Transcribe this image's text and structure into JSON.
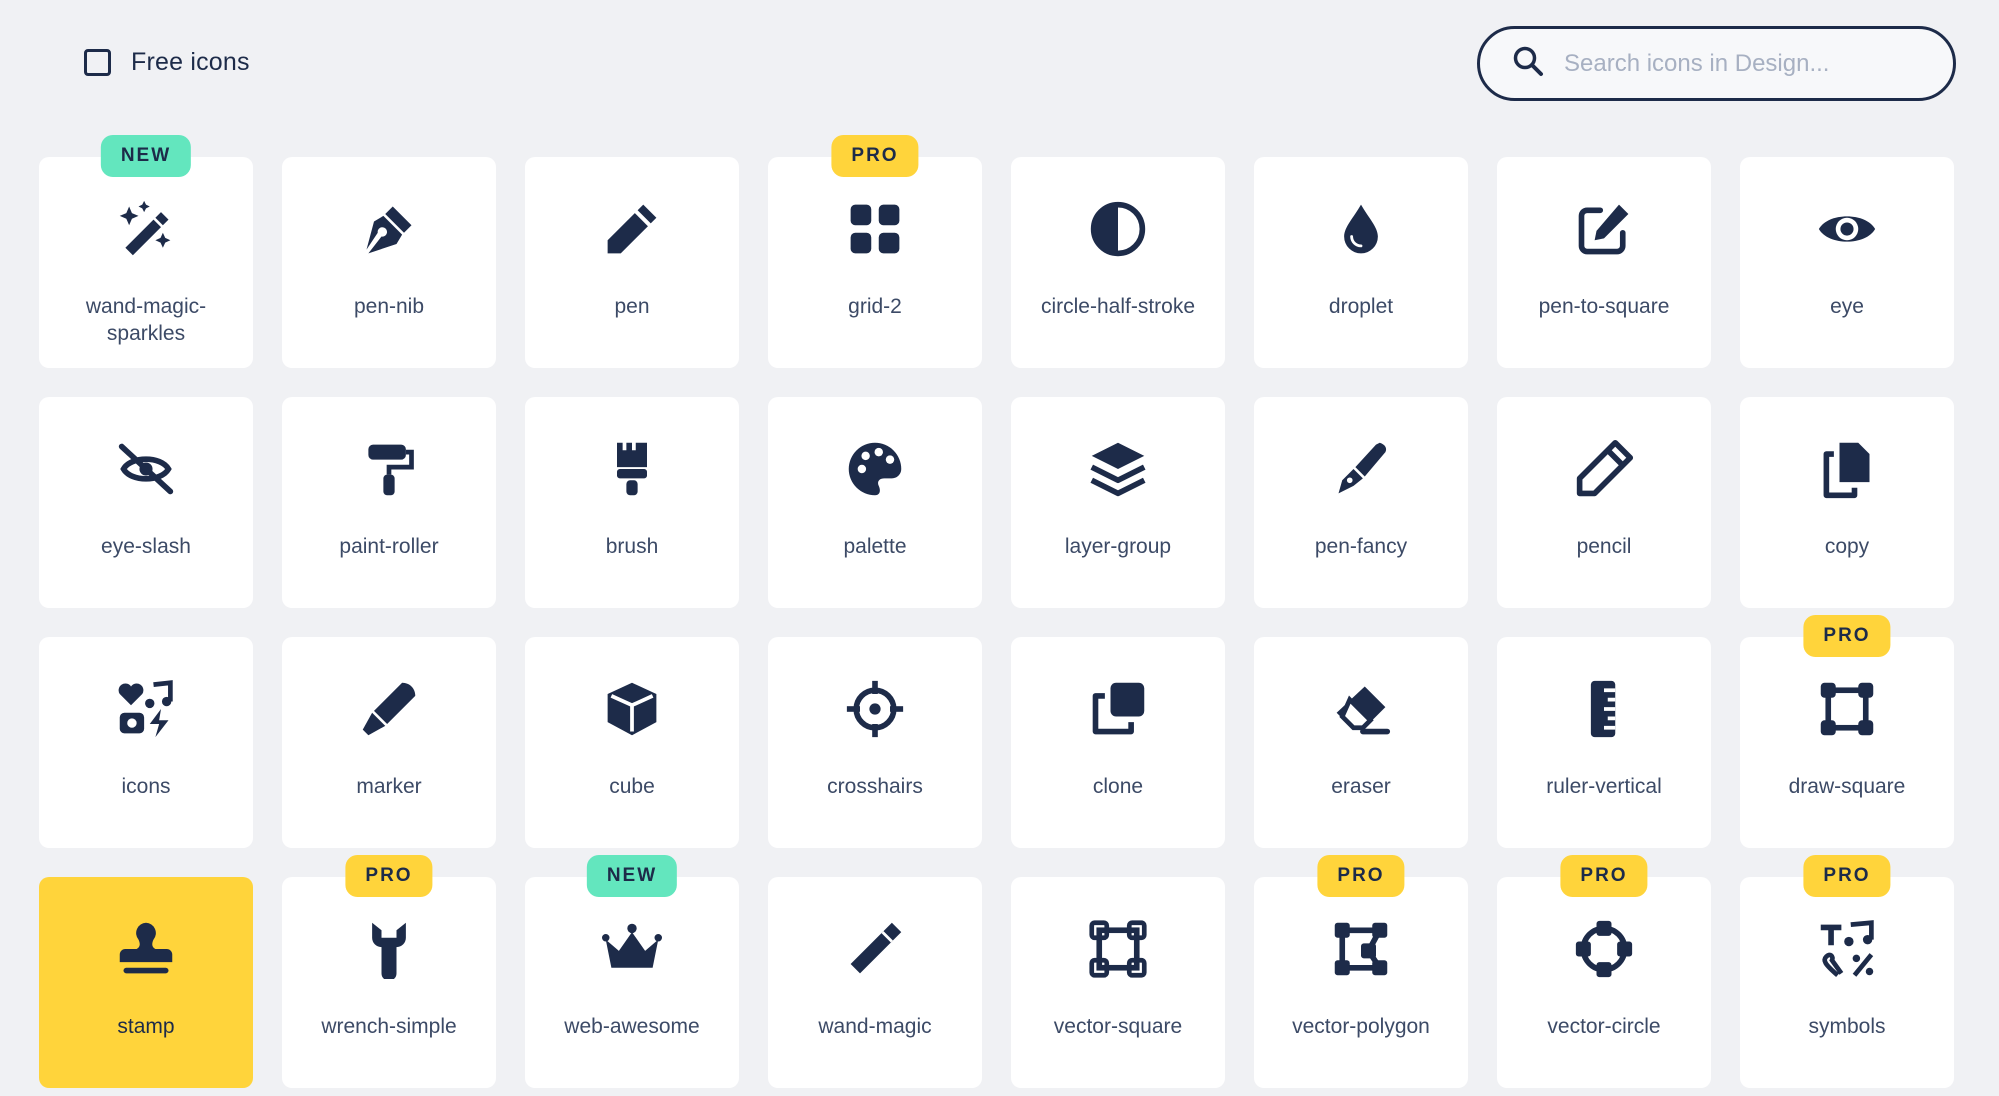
{
  "filter": {
    "free_label": "Free icons"
  },
  "search": {
    "placeholder": "Search icons in Design..."
  },
  "colors": {
    "background": "#f0f1f4",
    "card": "#ffffff",
    "selected": "#ffd43b",
    "new_badge": "#63e6be",
    "pro_badge": "#ffd43b",
    "icon": "#1d2b49"
  },
  "icons": [
    {
      "label": "wand-magic-sparkles",
      "icon": "wand-magic-sparkles-icon",
      "badge": "NEW"
    },
    {
      "label": "pen-nib",
      "icon": "pen-nib-icon",
      "badge": ""
    },
    {
      "label": "pen",
      "icon": "pen-icon",
      "badge": ""
    },
    {
      "label": "grid-2",
      "icon": "grid-2-icon",
      "badge": "PRO"
    },
    {
      "label": "circle-half-stroke",
      "icon": "circle-half-stroke-icon",
      "badge": ""
    },
    {
      "label": "droplet",
      "icon": "droplet-icon",
      "badge": ""
    },
    {
      "label": "pen-to-square",
      "icon": "pen-to-square-icon",
      "badge": ""
    },
    {
      "label": "eye",
      "icon": "eye-icon",
      "badge": ""
    },
    {
      "label": "eye-slash",
      "icon": "eye-slash-icon",
      "badge": ""
    },
    {
      "label": "paint-roller",
      "icon": "paint-roller-icon",
      "badge": ""
    },
    {
      "label": "brush",
      "icon": "brush-icon",
      "badge": ""
    },
    {
      "label": "palette",
      "icon": "palette-icon",
      "badge": ""
    },
    {
      "label": "layer-group",
      "icon": "layer-group-icon",
      "badge": ""
    },
    {
      "label": "pen-fancy",
      "icon": "pen-fancy-icon",
      "badge": ""
    },
    {
      "label": "pencil",
      "icon": "pencil-icon",
      "badge": ""
    },
    {
      "label": "copy",
      "icon": "copy-icon",
      "badge": ""
    },
    {
      "label": "icons",
      "icon": "icons-icon",
      "badge": ""
    },
    {
      "label": "marker",
      "icon": "marker-icon",
      "badge": ""
    },
    {
      "label": "cube",
      "icon": "cube-icon",
      "badge": ""
    },
    {
      "label": "crosshairs",
      "icon": "crosshairs-icon",
      "badge": ""
    },
    {
      "label": "clone",
      "icon": "clone-icon",
      "badge": ""
    },
    {
      "label": "eraser",
      "icon": "eraser-icon",
      "badge": ""
    },
    {
      "label": "ruler-vertical",
      "icon": "ruler-vertical-icon",
      "badge": ""
    },
    {
      "label": "draw-square",
      "icon": "draw-square-icon",
      "badge": "PRO"
    },
    {
      "label": "stamp",
      "icon": "stamp-icon",
      "badge": "",
      "selected": true
    },
    {
      "label": "wrench-simple",
      "icon": "wrench-simple-icon",
      "badge": "PRO"
    },
    {
      "label": "web-awesome",
      "icon": "web-awesome-icon",
      "badge": "NEW"
    },
    {
      "label": "wand-magic",
      "icon": "wand-magic-icon",
      "badge": ""
    },
    {
      "label": "vector-square",
      "icon": "vector-square-icon",
      "badge": ""
    },
    {
      "label": "vector-polygon",
      "icon": "vector-polygon-icon",
      "badge": "PRO"
    },
    {
      "label": "vector-circle",
      "icon": "vector-circle-icon",
      "badge": "PRO"
    },
    {
      "label": "symbols",
      "icon": "symbols-icon",
      "badge": "PRO"
    }
  ]
}
